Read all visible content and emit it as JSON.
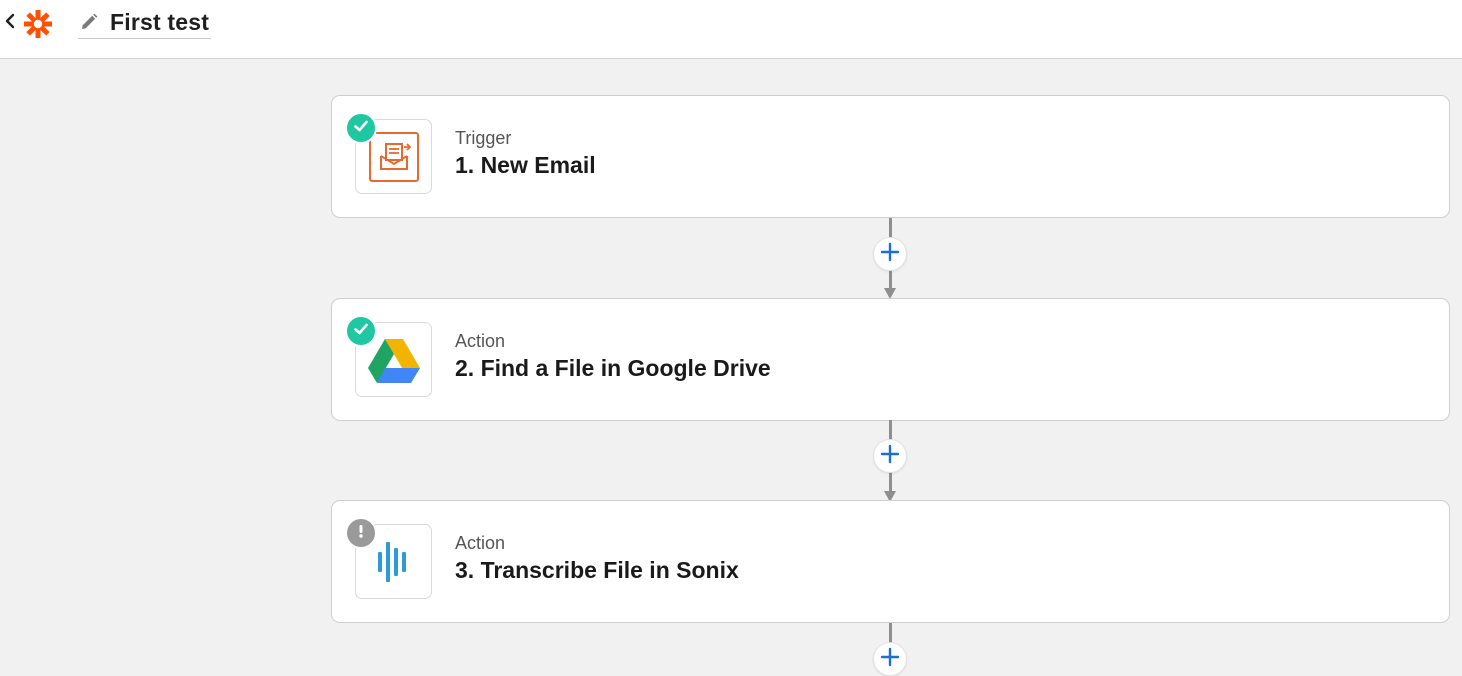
{
  "header": {
    "title": "First test",
    "back_icon": "chevron-left-icon",
    "logo_icon": "zapier-asterisk-icon",
    "edit_icon": "pencil-icon",
    "logo_color": "#ff4f00"
  },
  "steps": [
    {
      "type_label": "Trigger",
      "title": "1. New Email",
      "app_icon": "email-parser-icon",
      "status": "complete",
      "status_icon": "check-icon"
    },
    {
      "type_label": "Action",
      "title": "2. Find a File in Google Drive",
      "app_icon": "google-drive-icon",
      "status": "complete",
      "status_icon": "check-icon"
    },
    {
      "type_label": "Action",
      "title": "3. Transcribe File in Sonix",
      "app_icon": "sonix-icon",
      "status": "warning",
      "status_icon": "exclamation-icon"
    }
  ],
  "add_step_icon": "plus-icon",
  "colors": {
    "complete": "#1fc7a3",
    "warning": "#9a9a9a",
    "add_button_plus": "#1a6fd6",
    "connector": "#8e8e8e",
    "email_parser": "#e8692f",
    "sonix": "#2e9bd6"
  }
}
